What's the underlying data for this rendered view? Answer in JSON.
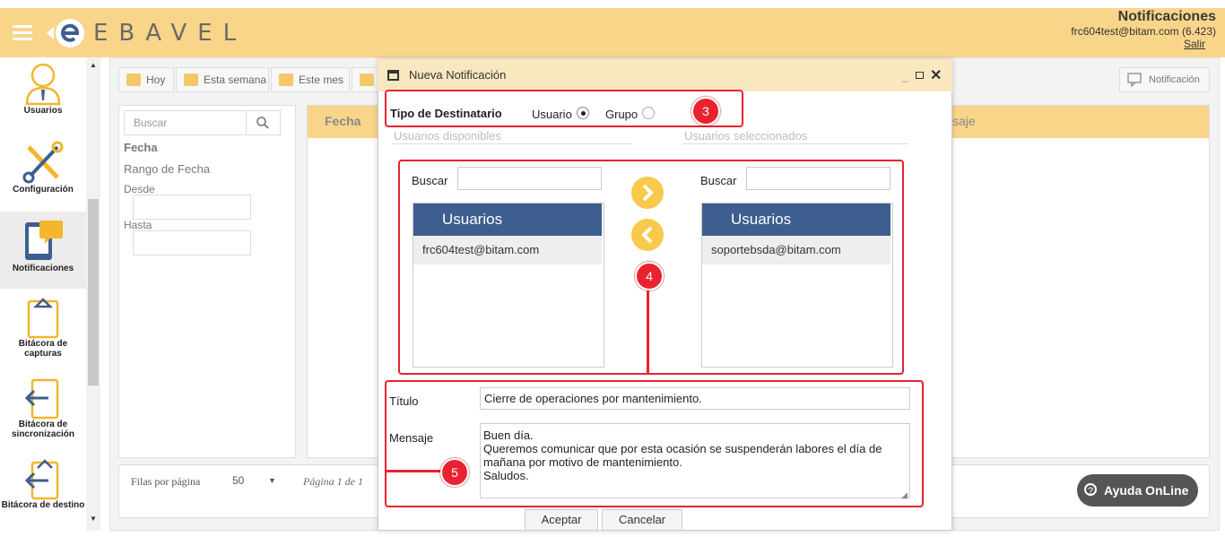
{
  "header": {
    "logo_text": "EBAVEL",
    "title": "Notificaciones",
    "user": "frc604test@bitam.com  (6.423)",
    "logout": "Salir"
  },
  "sidebar": {
    "items": [
      {
        "label": "Usuarios",
        "icon": "user-icon"
      },
      {
        "label": "Configuración",
        "icon": "tools-icon"
      },
      {
        "label": "Notificaciones",
        "icon": "tablet-chat-icon"
      },
      {
        "label": "Bitácora de capturas",
        "icon": "clipboard-icon"
      },
      {
        "label": "Bitácora de sincronización",
        "icon": "sync-arrow-icon"
      },
      {
        "label": "Bitácora de destino",
        "icon": "destination-arrow-icon"
      }
    ]
  },
  "toolbar": {
    "today": "Hoy",
    "this_week": "Esta semana",
    "this_month": "Este mes",
    "notification": "Notificación"
  },
  "filters": {
    "search_placeholder": "Buscar",
    "fecha": "Fecha",
    "rango": "Rango de Fecha",
    "desde": "Desde",
    "hasta": "Hasta"
  },
  "grid": {
    "col_fecha": "Fecha",
    "col_mensaje": "saje"
  },
  "footer": {
    "rows_label": "Filas por página",
    "rows_value": "50",
    "page_info": "Página 1 de 1",
    "help": "Ayuda OnLine"
  },
  "modal": {
    "title": "Nueva Notificación",
    "dest_label": "Tipo de Destinatario",
    "opt_usuario": "Usuario",
    "opt_grupo": "Grupo",
    "avail_label": "Usuarios disponibles",
    "sel_label": "Usuarios seleccionados",
    "buscar": "Buscar",
    "list_header": "Usuarios",
    "available_users": [
      "frc604test@bitam.com"
    ],
    "selected_users": [
      "soportebsda@bitam.com"
    ],
    "titulo_label": "Título",
    "titulo_value": "Cierre de operaciones por mantenimiento.",
    "mensaje_label": "Mensaje",
    "mensaje_value": "Buen día.\nQueremos comunicar que por esta ocasión se suspenderán labores el día de mañana por motivo de mantenimiento.\nSaludos.",
    "accept": "Aceptar",
    "cancel": "Cancelar"
  },
  "annotations": {
    "badge3": "3",
    "badge4": "4",
    "badge5": "5"
  },
  "colors": {
    "header_bg": "#f9d58a",
    "list_header_bg": "#3d5e8f",
    "annotation_red": "#e8232f",
    "arrow_yellow": "#f8c94a"
  }
}
